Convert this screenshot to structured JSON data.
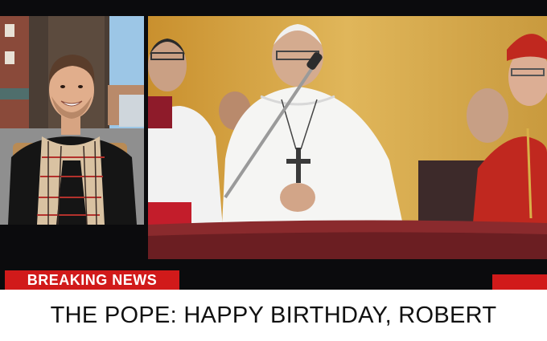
{
  "breaking_label": "BREAKING NEWS",
  "headline": "THE POPE: HAPPY BIRTHDAY, ROBERT",
  "colors": {
    "accent_red": "#d11a1a",
    "ticker_bg": "#ffffff",
    "frame_bg": "#0b0b0d"
  }
}
